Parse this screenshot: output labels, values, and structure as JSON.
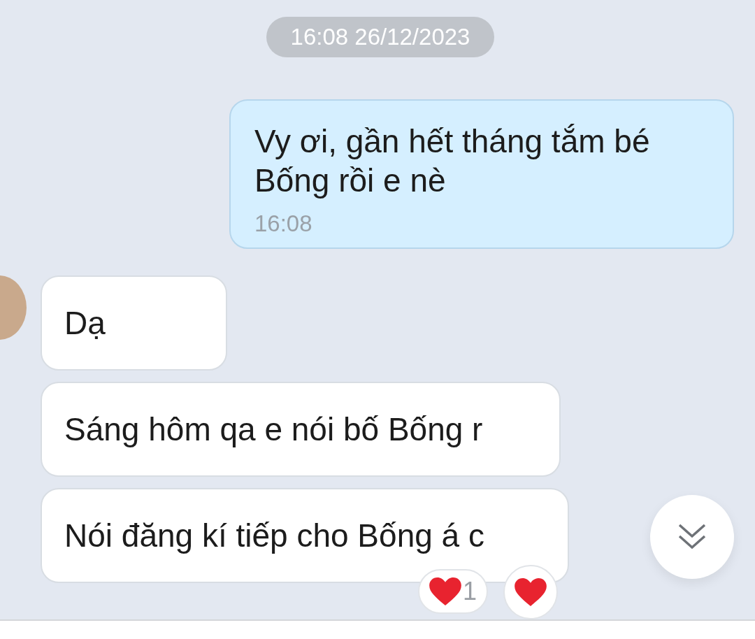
{
  "date_divider": "16:08 26/12/2023",
  "messages": [
    {
      "kind": "sent",
      "text": "Vy ơi, gần hết tháng tắm bé Bống rồi e nè",
      "time": "16:08"
    },
    {
      "kind": "received",
      "text": "Dạ",
      "avatar": true
    },
    {
      "kind": "received",
      "text": "Sáng hôm qa e nói bố Bống r",
      "avatar": false
    },
    {
      "kind": "received",
      "text": "Nói đăng kí tiếp cho Bống á c",
      "avatar": false,
      "reactions": [
        {
          "kind": "count",
          "count": "1"
        },
        {
          "kind": "add"
        }
      ]
    }
  ]
}
